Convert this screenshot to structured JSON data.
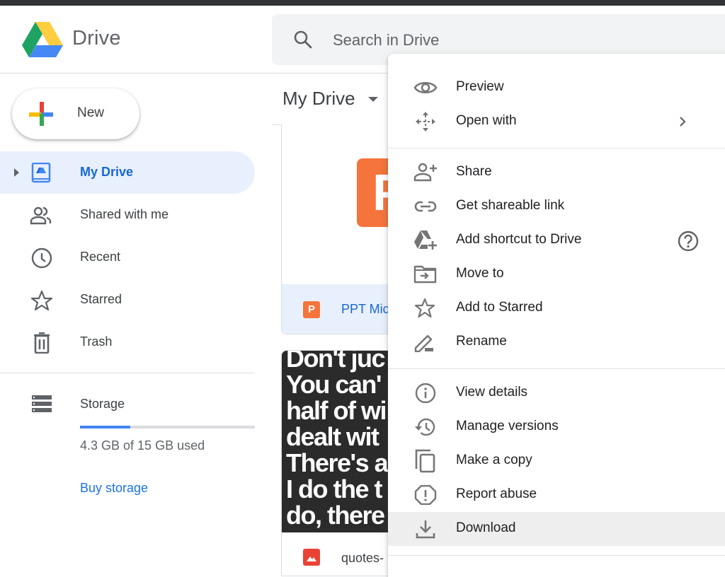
{
  "app": {
    "name": "Drive"
  },
  "search": {
    "placeholder": "Search in Drive"
  },
  "new_button": {
    "label": "New"
  },
  "sidebar": {
    "items": [
      {
        "label": "My Drive",
        "icon": "my-drive-icon",
        "active": true
      },
      {
        "label": "Shared with me",
        "icon": "people-icon"
      },
      {
        "label": "Recent",
        "icon": "clock-icon"
      },
      {
        "label": "Starred",
        "icon": "star-icon"
      },
      {
        "label": "Trash",
        "icon": "trash-icon"
      }
    ],
    "storage": {
      "label": "Storage",
      "used_text": "4.3 GB of 15 GB used",
      "used_fraction": 0.287,
      "buy_label": "Buy storage"
    }
  },
  "main": {
    "breadcrumb": "My Drive",
    "files": [
      {
        "name": "PPT Mic",
        "type": "powerpoint",
        "selected": true,
        "thumb_letter": "P"
      },
      {
        "name": "quotes-",
        "type": "image",
        "thumb_lines": [
          "Don't juc",
          "You can'",
          "half of wi",
          "dealt wit",
          "There's a",
          "I do the t",
          "do, there"
        ]
      }
    ]
  },
  "context_menu": {
    "groups": [
      [
        {
          "label": "Preview",
          "icon": "eye-icon"
        },
        {
          "label": "Open with",
          "icon": "move-arrows-icon",
          "submenu": true
        }
      ],
      [
        {
          "label": "Share",
          "icon": "person-add-icon"
        },
        {
          "label": "Get shareable link",
          "icon": "link-icon"
        },
        {
          "label": "Add shortcut to Drive",
          "icon": "drive-add-icon",
          "help": true
        },
        {
          "label": "Move to",
          "icon": "folder-move-icon"
        },
        {
          "label": "Add to Starred",
          "icon": "star-icon"
        },
        {
          "label": "Rename",
          "icon": "pencil-icon"
        }
      ],
      [
        {
          "label": "View details",
          "icon": "info-icon"
        },
        {
          "label": "Manage versions",
          "icon": "history-icon"
        },
        {
          "label": "Make a copy",
          "icon": "copy-icon"
        },
        {
          "label": "Report abuse",
          "icon": "report-icon"
        },
        {
          "label": "Download",
          "icon": "download-icon",
          "hovered": true
        }
      ]
    ]
  },
  "colors": {
    "accent": "#1a73e8",
    "active_bg": "#e8f0fe",
    "ppt": "#f4743b",
    "image": "#ea4335"
  }
}
